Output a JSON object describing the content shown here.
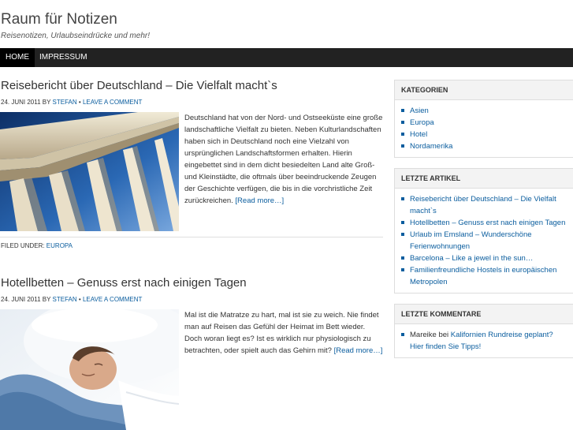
{
  "site": {
    "title": "Raum für Notizen",
    "description": "Reisenotizen, Urlaubseindrücke und mehr!"
  },
  "nav": {
    "items": [
      {
        "label": "HOME"
      },
      {
        "label": "IMPRESSUM"
      }
    ]
  },
  "posts": [
    {
      "title": "Reisebericht über Deutschland – Die Vielfalt macht`s",
      "date": "24. JUNI 2011",
      "by": "BY",
      "author": "STEFAN",
      "sep": "•",
      "comment_link": "LEAVE A COMMENT",
      "excerpt": "Deutschland hat von der Nord- und Ostseeküste eine große landschaftliche Vielfalt zu bieten. Neben Kulturlandschaften haben sich in Deutschland noch eine Vielzahl von ursprünglichen Landschaftsformen erhalten. Hierin eingebettet sind in dem dicht besiedelten Land alte Groß- und Kleinstädte, die oftmals über beeindruckende Zeugen der Geschichte verfügen, die bis in die vorchristliche Zeit zurückreichen.",
      "read_more": "[Read more…]",
      "filed_label": "FILED UNDER:",
      "filed_category": "EUROPA"
    },
    {
      "title": "Hotellbetten – Genuss erst nach einigen Tagen",
      "date": "24. JUNI 2011",
      "by": "BY",
      "author": "STEFAN",
      "sep": "•",
      "comment_link": "LEAVE A COMMENT",
      "excerpt": "Mal ist die Matratze zu hart, mal ist sie zu weich. Nie findet man auf Reisen das Gefühl der Heimat im Bett wieder. Doch woran liegt es? Ist es wirklich nur physiologisch zu betrachten, oder spielt auch das Gehirn mit?",
      "read_more": "[Read more…]"
    }
  ],
  "sidebar": {
    "kategorien": {
      "title": "KATEGORIEN",
      "items": [
        "Asien",
        "Europa",
        "Hotel",
        "Nordamerika"
      ]
    },
    "letzte_artikel": {
      "title": "LETZTE ARTIKEL",
      "items": [
        "Reisebericht über Deutschland – Die Vielfalt macht`s",
        "Hotellbetten – Genuss erst nach einigen Tagen",
        "Urlaub im Emsland – Wunderschöne Ferienwohnungen",
        "Barcelona – Like a jewel in the sun…",
        "Familienfreundliche Hostels in europäischen Metropolen"
      ]
    },
    "letzte_kommentare": {
      "title": "LETZTE KOMMENTARE",
      "author": "Mareike",
      "bei": "bei",
      "link": "Kalifornien Rundreise geplant? Hier finden Sie Tipps!"
    }
  },
  "colors": {
    "link": "#0a5d9e",
    "nav_bg": "#222222",
    "nav_active": "#000000"
  }
}
